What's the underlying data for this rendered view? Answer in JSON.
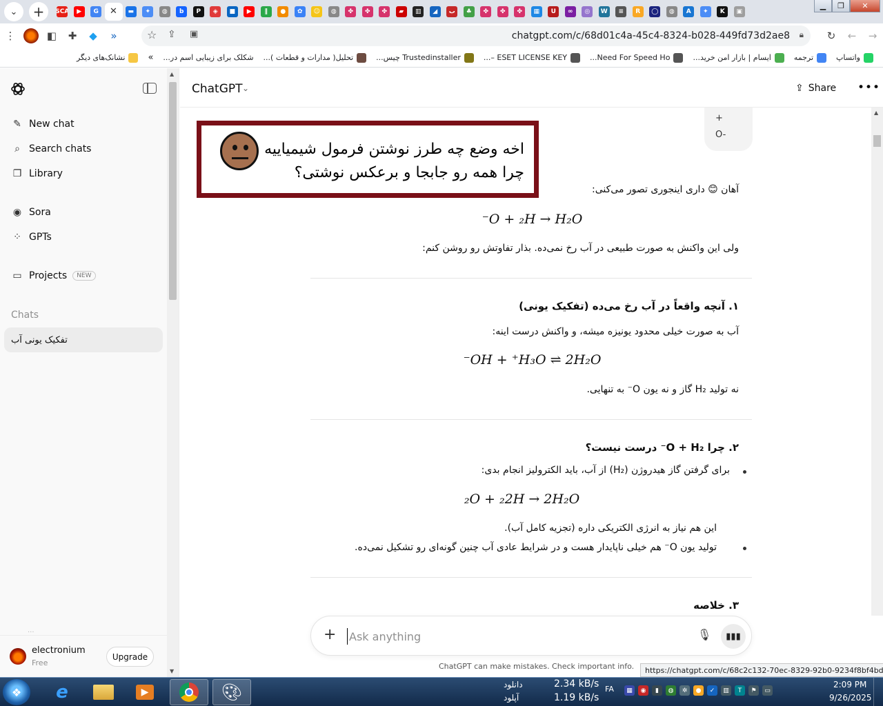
{
  "browser": {
    "url": "chatgpt.com/c/68d01c4a-45c4-8324-b028-449fd73d2ae8",
    "tabs": [
      {
        "icon": "yt-icon",
        "color": "#e62117",
        "glyph": "SCA"
      },
      {
        "icon": "youtube-icon",
        "color": "#ff0000",
        "glyph": "▶"
      },
      {
        "icon": "google-icon",
        "color": "#4285f4",
        "glyph": "G"
      },
      {
        "icon": "close-icon",
        "color": "#ffffff",
        "glyph": "✕",
        "active": true
      },
      {
        "icon": "site-icon",
        "color": "#1a73e8",
        "glyph": "▬"
      },
      {
        "icon": "gemini-icon",
        "color": "#4c8df6",
        "glyph": "✦"
      },
      {
        "icon": "globe-icon",
        "color": "#888888",
        "glyph": "◍"
      },
      {
        "icon": "b-icon",
        "color": "#1463ff",
        "glyph": "b"
      },
      {
        "icon": "pnet-icon",
        "color": "#111111",
        "glyph": "P"
      },
      {
        "icon": "shield-icon",
        "color": "#e03a3a",
        "glyph": "◈"
      },
      {
        "icon": "bluesquare-icon",
        "color": "#0a66c2",
        "glyph": "■"
      },
      {
        "icon": "youtube-icon",
        "color": "#ff0000",
        "glyph": "▶"
      },
      {
        "icon": "green-icon",
        "color": "#2aa84a",
        "glyph": "∥"
      },
      {
        "icon": "colorball-icon",
        "color": "#f28b00",
        "glyph": "●"
      },
      {
        "icon": "chatgpt-icon",
        "color": "#3b82f6",
        "glyph": "✿"
      },
      {
        "icon": "smile-icon",
        "color": "#f5c518",
        "glyph": "☺"
      },
      {
        "icon": "globe-icon",
        "color": "#888888",
        "glyph": "◍"
      },
      {
        "icon": "raspberry-icon",
        "color": "#d6336c",
        "glyph": "✤"
      },
      {
        "icon": "raspberry-icon",
        "color": "#d6336c",
        "glyph": "✤"
      },
      {
        "icon": "raspberry-icon",
        "color": "#d6336c",
        "glyph": "✤"
      },
      {
        "icon": "flag-icon",
        "color": "#cc0000",
        "glyph": "▰"
      },
      {
        "icon": "piano-icon",
        "color": "#222222",
        "glyph": "▥"
      },
      {
        "icon": "d-icon",
        "color": "#1565c0",
        "glyph": "◢"
      },
      {
        "icon": "arabic-icon",
        "color": "#c62828",
        "glyph": "ب"
      },
      {
        "icon": "tree-icon",
        "color": "#43a047",
        "glyph": "♣"
      },
      {
        "icon": "raspberry-icon",
        "color": "#d6336c",
        "glyph": "✤"
      },
      {
        "icon": "raspberry-icon",
        "color": "#d6336c",
        "glyph": "✤"
      },
      {
        "icon": "raspberry-icon",
        "color": "#d6336c",
        "glyph": "✤"
      },
      {
        "icon": "grid-icon",
        "color": "#1e88e5",
        "glyph": "▦"
      },
      {
        "icon": "u-icon",
        "color": "#b71c1c",
        "glyph": "U"
      },
      {
        "icon": "link-icon",
        "color": "#7b1fa2",
        "glyph": "∞"
      },
      {
        "icon": "face-icon",
        "color": "#9575cd",
        "glyph": "◎"
      },
      {
        "icon": "wordpress-icon",
        "color": "#21759b",
        "glyph": "W"
      },
      {
        "icon": "list-icon",
        "color": "#555555",
        "glyph": "≡"
      },
      {
        "icon": "r-icon",
        "color": "#f9a825",
        "glyph": "R"
      },
      {
        "icon": "circle-icon",
        "color": "#1a237e",
        "glyph": "◯"
      },
      {
        "icon": "globe-icon",
        "color": "#888888",
        "glyph": "◍"
      },
      {
        "icon": "aud-icon",
        "color": "#1976d2",
        "glyph": "A"
      },
      {
        "icon": "gemini-icon",
        "color": "#4c8df6",
        "glyph": "✦"
      },
      {
        "icon": "k-icon",
        "color": "#111111",
        "glyph": "K"
      },
      {
        "icon": "puzzle-icon",
        "color": "#9e9e9e",
        "glyph": "▣"
      }
    ],
    "bookmarks": [
      {
        "label": "واتساپ",
        "icon": "whatsapp-icon",
        "color": "#25d366"
      },
      {
        "label": "ترجمه",
        "icon": "translate-icon",
        "color": "#4285f4"
      },
      {
        "label": "ایسام | بازار امن خرید...",
        "icon": "shop-icon",
        "color": "#4caf50"
      },
      {
        "label": "Need For Speed Ho...",
        "icon": "globe-icon",
        "color": "#555555"
      },
      {
        "label": "ESET LICENSE KEY –...",
        "icon": "globe-icon",
        "color": "#555555"
      },
      {
        "label": "Trustedinstaller چیس...",
        "icon": "badge-icon",
        "color": "#827717"
      },
      {
        "label": "تحلیل( مدارات و قطعات )...",
        "icon": "grid-icon",
        "color": "#6d4c41"
      },
      {
        "label": "شکلک برای زیبایی اسم در...",
        "icon": "",
        "color": ""
      },
      {
        "label": "نشانک‌های دیگر",
        "icon": "folder-icon",
        "color": "#f6c744"
      }
    ]
  },
  "sidebar": {
    "items": [
      {
        "label": "New chat",
        "icon": "✎",
        "name": "new-chat"
      },
      {
        "label": "Search chats",
        "icon": "⌕",
        "name": "search-chats"
      },
      {
        "label": "Library",
        "icon": "❐",
        "name": "library"
      },
      {
        "label": "Sora",
        "icon": "◉",
        "name": "sora"
      },
      {
        "label": "GPTs",
        "icon": "⁘",
        "name": "gpts"
      },
      {
        "label": "Projects",
        "icon": "▭",
        "name": "projects"
      }
    ],
    "new_badge": "NEW",
    "chats_label": "Chats",
    "active_chat": "تفکیک یونی آب",
    "faded_item": "...",
    "user": {
      "name": "electronium",
      "plan": "Free"
    },
    "upgrade_label": "Upgrade"
  },
  "header": {
    "model": "ChatGPT",
    "share_label": "Share",
    "more_label": "•••"
  },
  "conversation": {
    "user_bubble_line1": "+",
    "user_bubble_line2": "O-",
    "meme_text": "اخه وضع چه طرز نوشتن فرمول شیمیاییه چرا همه رو جابجا و برعکس نوشتی؟",
    "intro": "آهان 😊 داری اینجوری تصور می‌کنی:",
    "eq1": "⁻O + ₂H → H₂O",
    "note1": "ولی این واکنش به صورت طبیعی در آب رخ نمی‌ده. بذار تفاوتش رو روشن کنم:",
    "h1": "۱. آنچه واقعاً در آب رخ می‌ده (تفکیک یونی)",
    "p1": "آب به صورت خیلی محدود یونیزه میشه، و واکنش درست اینه:",
    "eq2": "⁻OH + ⁺H₃O ⇌ 2H₂O",
    "p2": "نه تولید H₂ گاز و نه یون O⁻ به تنهایی.",
    "h2": "۲. چرا O + H₂⁻ درست نیست؟",
    "b1": "برای گرفتن گاز هیدروژن (H₂) از آب، باید الکترولیز انجام بدی:",
    "eq3": "₂O + ₂2H → 2H₂O",
    "b1_note": "این هم نیاز به انرژی الکتریکی داره (تجزیه کامل آب).",
    "b2": "تولید یون O⁻ هم خیلی ناپایدار هست و در شرایط عادی آب چنین گونه‌ای رو تشکیل نمی‌ده.",
    "h3": "۳. خلاصه"
  },
  "composer": {
    "placeholder": "Ask anything",
    "disclaimer": "ChatGPT can make mistakes. Check important info."
  },
  "status_link": "https://chatgpt.com/c/68c2c132-70ec-8329-92b0-9234f8bf4bd7",
  "taskbar": {
    "download_label": "دانلود",
    "upload_label": "آپلود",
    "download_speed": "2.34 kB/s",
    "upload_speed": "1.19 kB/s",
    "lang": "FA",
    "time": "2:09 PM",
    "date": "9/26/2025"
  }
}
